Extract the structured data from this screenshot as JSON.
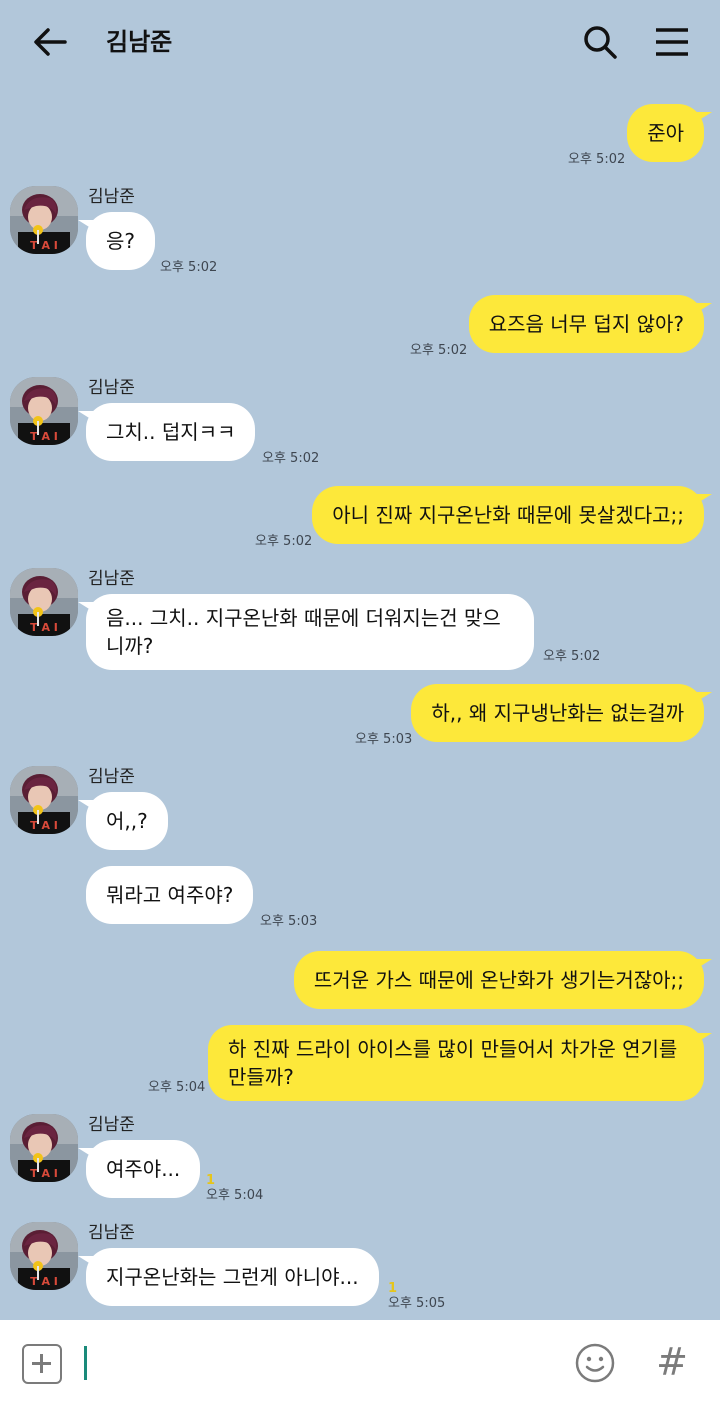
{
  "header": {
    "title": "김남준",
    "back_icon": "arrow-left-icon",
    "search_icon": "search-icon",
    "menu_icon": "hamburger-menu-icon"
  },
  "messages": [
    {
      "side": "me",
      "text": "준아",
      "time": "오후 5:02"
    },
    {
      "side": "other",
      "sender": "김남준",
      "text": "응?",
      "time": "오후 5:02"
    },
    {
      "side": "me",
      "text": "요즈음 너무 덥지 않아?",
      "time": "오후 5:02"
    },
    {
      "side": "other",
      "sender": "김남준",
      "text": "그치.. 덥지ㅋㅋ",
      "time": "오후 5:02"
    },
    {
      "side": "me",
      "text": "아니 진짜 지구온난화 때문에 못살겠다고;;",
      "time": "오후 5:02"
    },
    {
      "side": "other",
      "sender": "김남준",
      "text": "음... 그치.. 지구온난화 때문에 더워지는건 맞으니까?",
      "time": "오후 5:02"
    },
    {
      "side": "me",
      "text": "하,, 왜 지구냉난화는 없는걸까",
      "time": "오후 5:03"
    },
    {
      "side": "other",
      "sender": "김남준",
      "text": "어,,?"
    },
    {
      "side": "other",
      "text": "뭐라고 여주야?",
      "time": "오후 5:03"
    },
    {
      "side": "me",
      "text": "뜨거운 가스 때문에 온난화가 생기는거잖아;;"
    },
    {
      "side": "me",
      "text": "하 진짜 드라이 아이스를 많이 만들어서 차가운 연기를 만들까?",
      "time": "오후 5:04"
    },
    {
      "side": "other",
      "sender": "김남준",
      "text": "여주야...",
      "time": "오후 5:04",
      "unread": "1"
    },
    {
      "side": "other",
      "sender": "김남준",
      "text": "지구온난화는 그런게 아니야...",
      "time": "오후 5:05",
      "unread": "1"
    }
  ],
  "input_bar": {
    "plus_icon": "plus-square-icon",
    "input_value": "",
    "emoji_icon": "smiley-icon",
    "hash_icon": "hash-icon",
    "hash_glyph": "#"
  },
  "colors": {
    "background": "#b2c7da",
    "my_bubble": "#fde83a",
    "other_bubble": "#ffffff",
    "unread": "#e6c51b"
  }
}
